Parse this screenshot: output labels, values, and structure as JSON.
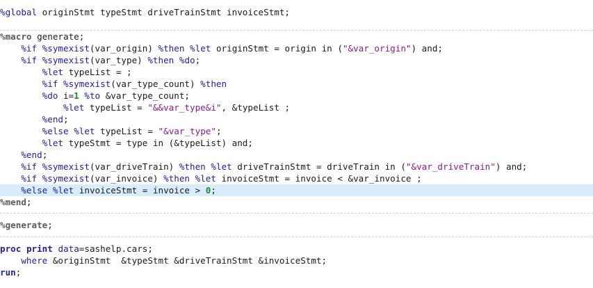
{
  "code": {
    "l1": [
      [
        "macro",
        "%global"
      ],
      [
        "plain",
        " originStmt typeStmt driveTrainStmt invoiceStmt;"
      ]
    ],
    "l3": [
      [
        "section",
        "%macro"
      ],
      [
        "plain",
        " generate;"
      ]
    ],
    "l4": [
      [
        "plain",
        "    "
      ],
      [
        "macro",
        "%if"
      ],
      [
        "plain",
        " "
      ],
      [
        "macro",
        "%symexist"
      ],
      [
        "plain",
        "(var_origin) "
      ],
      [
        "macro",
        "%then"
      ],
      [
        "plain",
        " "
      ],
      [
        "macro",
        "%let"
      ],
      [
        "plain",
        " originStmt = origin in ("
      ],
      [
        "string",
        "\"&var_origin\""
      ],
      [
        "plain",
        ") and;"
      ]
    ],
    "l5": [
      [
        "plain",
        "    "
      ],
      [
        "macro",
        "%if"
      ],
      [
        "plain",
        " "
      ],
      [
        "macro",
        "%symexist"
      ],
      [
        "plain",
        "(var_type) "
      ],
      [
        "macro",
        "%then"
      ],
      [
        "plain",
        " "
      ],
      [
        "macro",
        "%do"
      ],
      [
        "plain",
        ";"
      ]
    ],
    "l6": [
      [
        "plain",
        "        "
      ],
      [
        "macro",
        "%let"
      ],
      [
        "plain",
        " typeList = ;"
      ]
    ],
    "l7": [
      [
        "plain",
        "        "
      ],
      [
        "macro",
        "%if"
      ],
      [
        "plain",
        " "
      ],
      [
        "macro",
        "%symexist"
      ],
      [
        "plain",
        "(var_type_count) "
      ],
      [
        "macro",
        "%then"
      ]
    ],
    "l8": [
      [
        "plain",
        "        "
      ],
      [
        "macro",
        "%do"
      ],
      [
        "plain",
        " i="
      ],
      [
        "num",
        "1"
      ],
      [
        "plain",
        " "
      ],
      [
        "macro",
        "%to"
      ],
      [
        "plain",
        " &var_type_count;"
      ]
    ],
    "l9": [
      [
        "plain",
        "            "
      ],
      [
        "macro",
        "%let"
      ],
      [
        "plain",
        " typeList = "
      ],
      [
        "string",
        "\"&&var_type&i\""
      ],
      [
        "plain",
        ", &typeList ;"
      ]
    ],
    "l10": [
      [
        "plain",
        "        "
      ],
      [
        "macro",
        "%end"
      ],
      [
        "plain",
        ";"
      ]
    ],
    "l11": [
      [
        "plain",
        "        "
      ],
      [
        "macro",
        "%else"
      ],
      [
        "plain",
        " "
      ],
      [
        "macro",
        "%let"
      ],
      [
        "plain",
        " typeList = "
      ],
      [
        "string",
        "\"&var_type\""
      ],
      [
        "plain",
        ";"
      ]
    ],
    "l12": [
      [
        "plain",
        "        "
      ],
      [
        "macro",
        "%let"
      ],
      [
        "plain",
        " typeStmt = type in (&typeList) and;"
      ]
    ],
    "l13": [
      [
        "plain",
        "    "
      ],
      [
        "macro",
        "%end"
      ],
      [
        "plain",
        ";"
      ]
    ],
    "l14": [
      [
        "plain",
        "    "
      ],
      [
        "macro",
        "%if"
      ],
      [
        "plain",
        " "
      ],
      [
        "macro",
        "%symexist"
      ],
      [
        "plain",
        "(var_driveTrain) "
      ],
      [
        "macro",
        "%then"
      ],
      [
        "plain",
        " "
      ],
      [
        "macro",
        "%let"
      ],
      [
        "plain",
        " driveTrainStmt = driveTrain in ("
      ],
      [
        "string",
        "\"&var_driveTrain\""
      ],
      [
        "plain",
        ") and;"
      ]
    ],
    "l15": [
      [
        "plain",
        "    "
      ],
      [
        "macro",
        "%if"
      ],
      [
        "plain",
        " "
      ],
      [
        "macro",
        "%symexist"
      ],
      [
        "plain",
        "(var_invoice) "
      ],
      [
        "macro",
        "%then"
      ],
      [
        "plain",
        " "
      ],
      [
        "macro",
        "%let"
      ],
      [
        "plain",
        " invoiceStmt = invoice < &var_invoice ;"
      ]
    ],
    "l16": [
      [
        "plain",
        "    "
      ],
      [
        "macro",
        "%else"
      ],
      [
        "plain",
        " "
      ],
      [
        "macro",
        "%let"
      ],
      [
        "plain",
        " invoiceStmt = invoice > "
      ],
      [
        "num",
        "0"
      ],
      [
        "plain",
        ";"
      ]
    ],
    "l17": [
      [
        "section",
        "%mend"
      ],
      [
        "plain",
        ";"
      ]
    ],
    "l19": [
      [
        "section",
        "%generate"
      ],
      [
        "plain",
        ";"
      ]
    ],
    "l21": [
      [
        "kw",
        "proc"
      ],
      [
        "plain",
        " "
      ],
      [
        "kw",
        "print"
      ],
      [
        "plain",
        " "
      ],
      [
        "kwp",
        "data"
      ],
      [
        "plain",
        "=sashelp.cars;"
      ]
    ],
    "l22": [
      [
        "plain",
        "    "
      ],
      [
        "kwp",
        "where"
      ],
      [
        "plain",
        " &originStmt  &typeStmt &driveTrainStmt &invoiceStmt;"
      ]
    ],
    "l23": [
      [
        "kw",
        "run"
      ],
      [
        "plain",
        ";"
      ]
    ]
  },
  "colors": {
    "highlight": "#d9ecfb",
    "macro": "#1e1e9f",
    "string": "#8a1a8a",
    "number": "#1a8a2a"
  }
}
